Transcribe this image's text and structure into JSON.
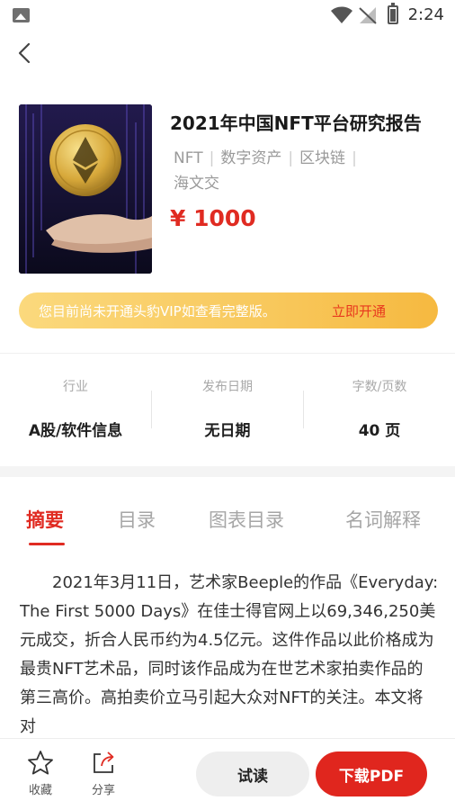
{
  "status_bar": {
    "time": "2:24",
    "icons": [
      "image-icon",
      "wifi-icon",
      "no-signal-icon",
      "battery-icon"
    ]
  },
  "nav": {
    "back_icon": "chevron-left-icon"
  },
  "book": {
    "title": "2021年中国NFT平台研究报告",
    "tags": [
      "NFT",
      "数字资产",
      "区块链",
      "海文交"
    ],
    "price": "¥ 1000",
    "cover_icon": "ethereum-coin-hand-cover"
  },
  "vip_banner": {
    "text": "您目前尚未开通头豹VIP如查看完整版。",
    "action": "立即开通"
  },
  "info": [
    {
      "label": "行业",
      "value": "A股/软件信息"
    },
    {
      "label": "发布日期",
      "value": "无日期"
    },
    {
      "label": "字数/页数",
      "value": "40 页"
    }
  ],
  "tabs": [
    {
      "label": "摘要",
      "active": true
    },
    {
      "label": "目录",
      "active": false
    },
    {
      "label": "图表目录",
      "active": false
    },
    {
      "label": "名词解释",
      "active": false
    }
  ],
  "abstract": "2021年3月11日，艺术家Beeple的作品《Everyday: The First 5000 Days》在佳士得官网上以69,346,250美元成交，折合人民币约为4.5亿元。这件作品以此价格成为最贵NFT艺术品，同时该作品成为在世艺术家拍卖作品的第三高价。高拍卖价立马引起大众对NFT的关注。本文将对",
  "bottom_bar": {
    "favorite_label": "收藏",
    "share_label": "分享",
    "trial_label": "试读",
    "download_label": "下载PDF"
  },
  "colors": {
    "accent": "#e02b22",
    "vip_gradient_start": "#fbd97d",
    "vip_gradient_end": "#f6b940"
  }
}
